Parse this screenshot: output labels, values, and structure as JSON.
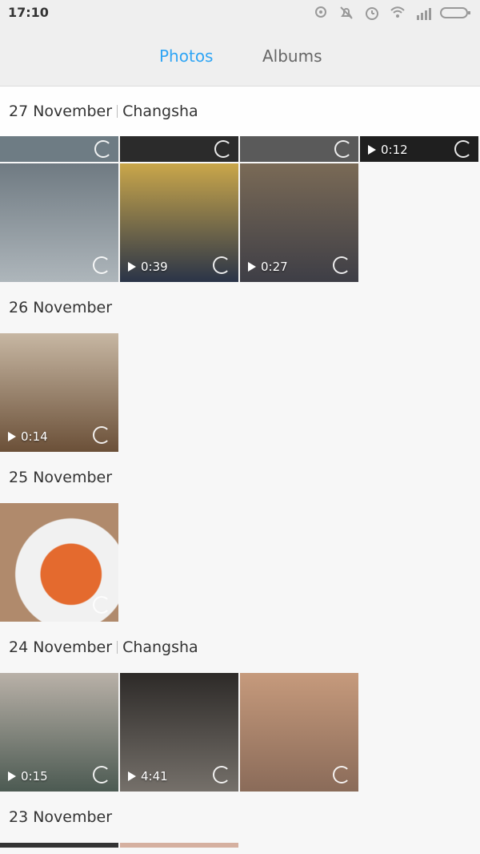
{
  "status": {
    "time": "17:10"
  },
  "tabs": [
    {
      "label": "Photos",
      "active": true
    },
    {
      "label": "Albums",
      "active": false
    }
  ],
  "sections": [
    {
      "date": "27 November",
      "location": "Changsha",
      "items": [
        {
          "duration": "0:12"
        },
        {
          "duration": "0:39"
        },
        {
          "duration": "0:27"
        }
      ]
    },
    {
      "date": "26 November",
      "items": [
        {
          "duration": "0:14"
        }
      ]
    },
    {
      "date": "25 November",
      "items": []
    },
    {
      "date": "24 November",
      "location": "Changsha",
      "items": [
        {
          "duration": "0:15"
        },
        {
          "duration": "4:41"
        }
      ]
    },
    {
      "date": "23 November"
    }
  ],
  "colors": {
    "accent": "#2fa5f5"
  }
}
